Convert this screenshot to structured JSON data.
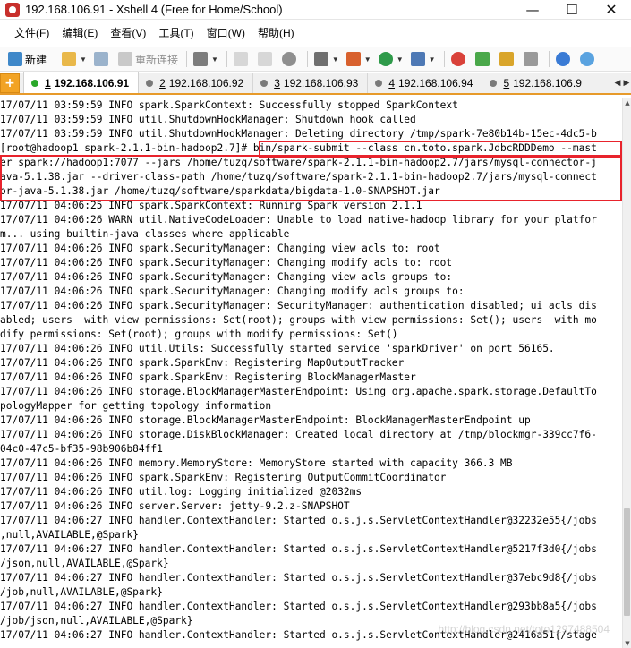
{
  "window": {
    "title": "192.168.106.91 - Xshell 4 (Free for Home/School)",
    "minimize_icon": "minimize-icon",
    "maximize_icon": "maximize-icon",
    "close_icon": "close-icon"
  },
  "menu": {
    "items": [
      "文件(F)",
      "编辑(E)",
      "查看(V)",
      "工具(T)",
      "窗口(W)",
      "帮助(H)"
    ]
  },
  "toolbar": {
    "new_label": "新建",
    "reconnect_label": "重新连接"
  },
  "tabs": [
    {
      "num": "1",
      "host": "192.168.106.91",
      "active": true
    },
    {
      "num": "2",
      "host": "192.168.106.92",
      "active": false
    },
    {
      "num": "3",
      "host": "192.168.106.93",
      "active": false
    },
    {
      "num": "4",
      "host": "192.168.106.94",
      "active": false
    },
    {
      "num": "5",
      "host": "192.168.106.9",
      "active": false
    }
  ],
  "terminal": {
    "lines": [
      "17/07/11 03:59:59 INFO spark.SparkContext: Successfully stopped SparkContext",
      "17/07/11 03:59:59 INFO util.ShutdownHookManager: Shutdown hook called",
      "17/07/11 03:59:59 INFO util.ShutdownHookManager: Deleting directory /tmp/spark-7e80b14b-15ec-4dc5-b",
      "[root@hadoop1 spark-2.1.1-bin-hadoop2.7]# bin/spark-submit --class cn.toto.spark.JdbcRDDDemo --mast",
      "er spark://hadoop1:7077 --jars /home/tuzq/software/spark-2.1.1-bin-hadoop2.7/jars/mysql-connector-j",
      "ava-5.1.38.jar --driver-class-path /home/tuzq/software/spark-2.1.1-bin-hadoop2.7/jars/mysql-connect",
      "or-java-5.1.38.jar /home/tuzq/software/sparkdata/bigdata-1.0-SNAPSHOT.jar",
      "17/07/11 04:06:25 INFO spark.SparkContext: Running Spark version 2.1.1",
      "17/07/11 04:06:26 WARN util.NativeCodeLoader: Unable to load native-hadoop library for your platfor",
      "m... using builtin-java classes where applicable",
      "17/07/11 04:06:26 INFO spark.SecurityManager: Changing view acls to: root",
      "17/07/11 04:06:26 INFO spark.SecurityManager: Changing modify acls to: root",
      "17/07/11 04:06:26 INFO spark.SecurityManager: Changing view acls groups to:",
      "17/07/11 04:06:26 INFO spark.SecurityManager: Changing modify acls groups to:",
      "17/07/11 04:06:26 INFO spark.SecurityManager: SecurityManager: authentication disabled; ui acls dis",
      "abled; users  with view permissions: Set(root); groups with view permissions: Set(); users  with mo",
      "dify permissions: Set(root); groups with modify permissions: Set()",
      "17/07/11 04:06:26 INFO util.Utils: Successfully started service 'sparkDriver' on port 56165.",
      "17/07/11 04:06:26 INFO spark.SparkEnv: Registering MapOutputTracker",
      "17/07/11 04:06:26 INFO spark.SparkEnv: Registering BlockManagerMaster",
      "17/07/11 04:06:26 INFO storage.BlockManagerMasterEndpoint: Using org.apache.spark.storage.DefaultTo",
      "pologyMapper for getting topology information",
      "17/07/11 04:06:26 INFO storage.BlockManagerMasterEndpoint: BlockManagerMasterEndpoint up",
      "17/07/11 04:06:26 INFO storage.DiskBlockManager: Created local directory at /tmp/blockmgr-339cc7f6-",
      "04c0-47c5-bf35-98b906b84ff1",
      "17/07/11 04:06:26 INFO memory.MemoryStore: MemoryStore started with capacity 366.3 MB",
      "17/07/11 04:06:26 INFO spark.SparkEnv: Registering OutputCommitCoordinator",
      "17/07/11 04:06:26 INFO util.log: Logging initialized @2032ms",
      "17/07/11 04:06:26 INFO server.Server: jetty-9.2.z-SNAPSHOT",
      "17/07/11 04:06:27 INFO handler.ContextHandler: Started o.s.j.s.ServletContextHandler@32232e55{/jobs",
      ",null,AVAILABLE,@Spark}",
      "17/07/11 04:06:27 INFO handler.ContextHandler: Started o.s.j.s.ServletContextHandler@5217f3d0{/jobs",
      "/json,null,AVAILABLE,@Spark}",
      "17/07/11 04:06:27 INFO handler.ContextHandler: Started o.s.j.s.ServletContextHandler@37ebc9d8{/jobs",
      "/job,null,AVAILABLE,@Spark}",
      "17/07/11 04:06:27 INFO handler.ContextHandler: Started o.s.j.s.ServletContextHandler@293bb8a5{/jobs",
      "/job/json,null,AVAILABLE,@Spark}",
      "17/07/11 04:06:27 INFO handler.ContextHandler: Started o.s.j.s.ServletContextHandler@2416a51{/stage"
    ],
    "highlight_color": "#e8232c"
  },
  "watermark": "http://blog.csdn.net/toto1297488504"
}
